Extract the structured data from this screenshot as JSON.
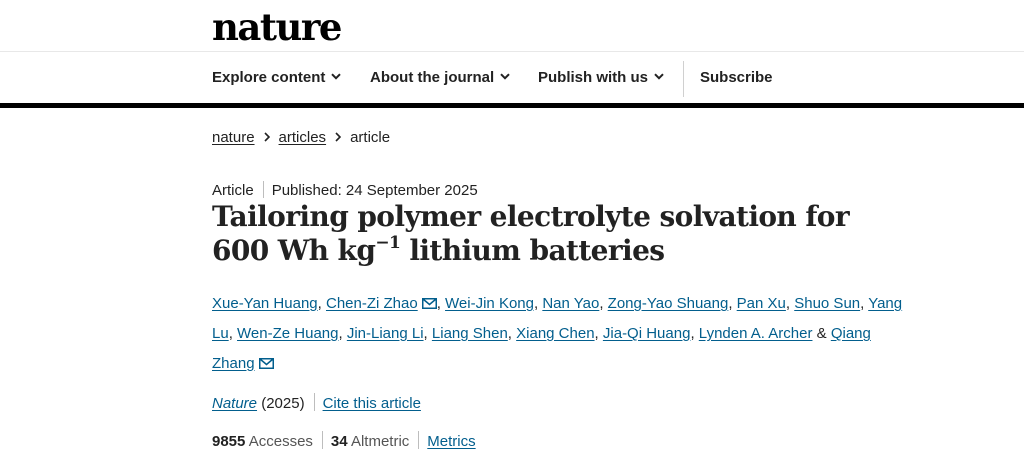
{
  "site": {
    "logo": "nature"
  },
  "nav": {
    "items": [
      {
        "label": "Explore content",
        "dropdown": true
      },
      {
        "label": "About the journal",
        "dropdown": true
      },
      {
        "label": "Publish with us",
        "dropdown": true
      },
      {
        "label": "Subscribe",
        "dropdown": false
      }
    ]
  },
  "breadcrumb": {
    "items": [
      "nature",
      "articles"
    ],
    "current": "article"
  },
  "article": {
    "type": "Article",
    "published": "Published: 24 September 2025",
    "title_part1": "Tailoring polymer electrolyte solvation for 600 Wh kg",
    "title_sup": "−1",
    "title_part2": " lithium batteries",
    "authors": [
      {
        "name": "Xue-Yan Huang",
        "email": false
      },
      {
        "name": "Chen-Zi Zhao",
        "email": true
      },
      {
        "name": "Wei-Jin Kong",
        "email": false
      },
      {
        "name": "Nan Yao",
        "email": false
      },
      {
        "name": "Zong-Yao Shuang",
        "email": false
      },
      {
        "name": "Pan Xu",
        "email": false
      },
      {
        "name": "Shuo Sun",
        "email": false
      },
      {
        "name": "Yang Lu",
        "email": false
      },
      {
        "name": "Wen-Ze Huang",
        "email": false
      },
      {
        "name": "Jin-Liang Li",
        "email": false
      },
      {
        "name": "Liang Shen",
        "email": false
      },
      {
        "name": "Xiang Chen",
        "email": false
      },
      {
        "name": "Jia-Qi Huang",
        "email": false
      },
      {
        "name": "Lynden A. Archer",
        "email": false
      },
      {
        "name": "Qiang Zhang",
        "email": true
      }
    ],
    "journal": "Nature",
    "year": "(2025)",
    "cite_label": "Cite this article",
    "accesses_count": "9855",
    "accesses_label": "Accesses",
    "altmetric_count": "34",
    "altmetric_label": "Altmetric",
    "metrics_label": "Metrics"
  },
  "colors": {
    "link": "#025e8d",
    "text": "#222222",
    "rule": "#000000"
  },
  "icons": {
    "dropdown": "chevron-down-icon",
    "breadcrumb_sep": "chevron-right-icon",
    "email": "mail-icon"
  }
}
